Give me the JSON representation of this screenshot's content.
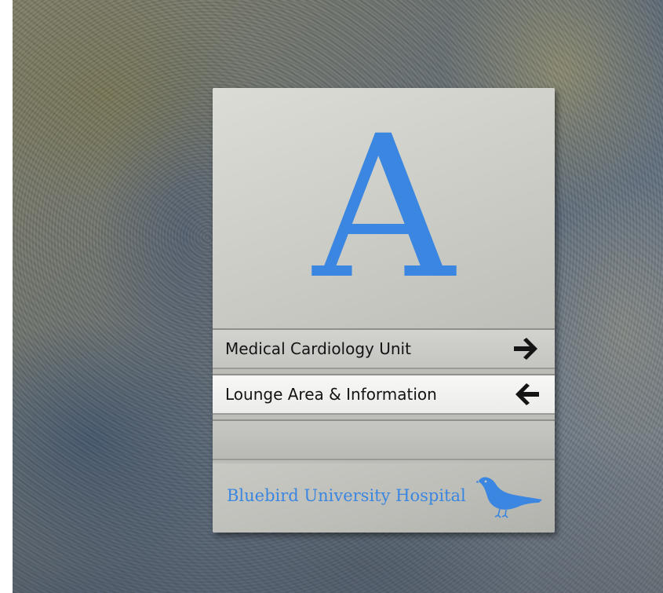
{
  "sign": {
    "letter": "A",
    "directions": [
      {
        "label": "Medical Cardiology Unit",
        "arrow": "right-arrow"
      },
      {
        "label": "Lounge Area & Information",
        "arrow": "left-arrow"
      },
      {
        "label": "",
        "arrow": ""
      }
    ],
    "hospital_name": "Bluebird University Hospital",
    "logo_icon": "bluebird-icon"
  },
  "colors": {
    "brand_blue": "#3a86e0",
    "text_dark": "#141414"
  }
}
